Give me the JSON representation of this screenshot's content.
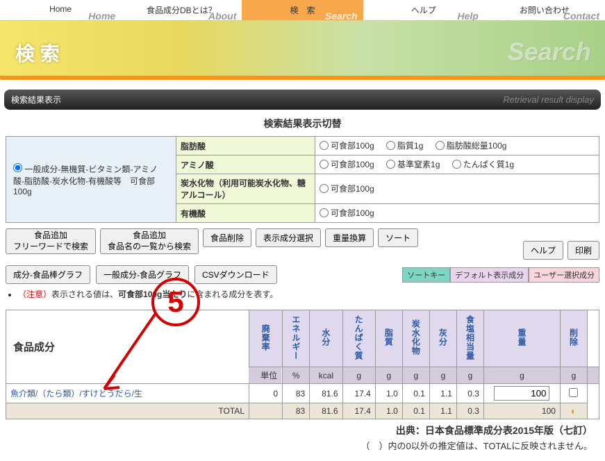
{
  "nav": {
    "items": [
      {
        "label": "Home",
        "sub": "Home"
      },
      {
        "label": "食品成分DBとは？",
        "sub": "About"
      },
      {
        "label": "検　索",
        "sub": "Search"
      },
      {
        "label": "ヘルプ",
        "sub": "Help"
      },
      {
        "label": "お問い合わせ",
        "sub": "Contact"
      }
    ],
    "active": 2
  },
  "hero": {
    "title": "検 索",
    "bg_text": "Search"
  },
  "subheader": {
    "jp": "検索結果表示",
    "en": "Retrieval result display"
  },
  "switch": {
    "title": "検索結果表示切替",
    "left_radio": "一般成分-無機質-ビタミン類-アミノ酸-脂肪酸-炭水化物-有機酸等　可食部100g",
    "rows": [
      {
        "mid": "脂肪酸",
        "opts": [
          "可食部100g",
          "脂質1g",
          "脂肪酸総量100g"
        ]
      },
      {
        "mid": "アミノ酸",
        "opts": [
          "可食部100g",
          "基準窒素1g",
          "たんぱく質1g"
        ]
      },
      {
        "mid": "炭水化物（利用可能炭水化物、糖アルコール）",
        "opts": [
          "可食部100g"
        ]
      },
      {
        "mid": "有機酸",
        "opts": [
          "可食部100g"
        ]
      }
    ]
  },
  "buttons": {
    "add_free": "食品追加\nフリーワードで検索",
    "add_list": "食品追加\n食品名の一覧から検索",
    "del": "食品削除",
    "sel": "表示成分選択",
    "convert": "重量換算",
    "sort": "ソート",
    "help": "ヘルプ",
    "print": "印刷",
    "bar": "成分-食品棒グラフ",
    "line": "一般成分-食品グラフ",
    "csv": "CSVダウンロード"
  },
  "legend": {
    "k1": "ソートキー",
    "k2": "デフォルト表示成分",
    "k3": "ユーザー選択成分"
  },
  "note": {
    "warn": "（注意）",
    "body_a": "表示される値は、",
    "body_b": "可食部100g当たり",
    "body_c": "に含まれる成分を表す。"
  },
  "table": {
    "rowlabel": "食品成分",
    "headers": [
      "廃棄率",
      "エネルギー",
      "水分",
      "たんぱく質",
      "脂質",
      "炭水化物",
      "灰分",
      "食塩相当量",
      "重量",
      "削除"
    ],
    "unit_label": "単位",
    "units": [
      "%",
      "kcal",
      "g",
      "g",
      "g",
      "g",
      "g",
      "g",
      "g",
      ""
    ],
    "rows": [
      {
        "name": "魚介類/（たら類）/すけとうだら/生",
        "vals": [
          "0",
          "83",
          "81.6",
          "17.4",
          "1.0",
          "0.1",
          "1.1",
          "0.3"
        ],
        "weight": "100"
      }
    ],
    "total_label": "TOTAL",
    "total": [
      "",
      "83",
      "81.6",
      "17.4",
      "1.0",
      "0.1",
      "1.1",
      "0.3",
      "100"
    ]
  },
  "footer": {
    "credit": "出典：日本食品標準成分表2015年版（七訂）",
    "note": "（　）内の0以外の推定値は、TOTALに反映されません。"
  },
  "annotation": {
    "num": "5"
  }
}
